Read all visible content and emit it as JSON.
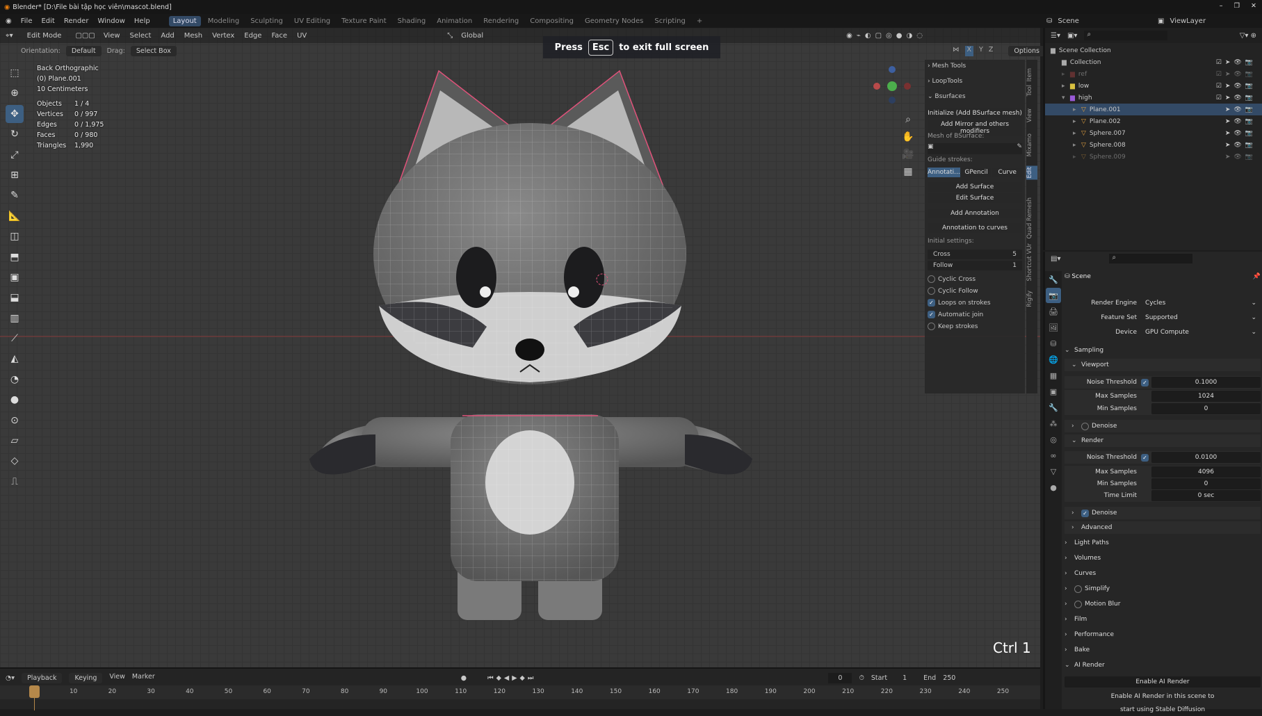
{
  "title": "Blender* [D:\\File bài tập học viên\\mascot.blend]",
  "window_controls": [
    "–",
    "❐",
    "✕"
  ],
  "menu": [
    "File",
    "Edit",
    "Render",
    "Window",
    "Help"
  ],
  "workspaces": [
    "Layout",
    "Modeling",
    "Sculpting",
    "UV Editing",
    "Texture Paint",
    "Shading",
    "Animation",
    "Rendering",
    "Compositing",
    "Geometry Nodes",
    "Scripting",
    "+"
  ],
  "active_workspace": "Layout",
  "scene_label": "Scene",
  "viewlayer_label": "ViewLayer",
  "viewport_header": {
    "mode": "Edit Mode",
    "menus": [
      "View",
      "Select",
      "Add",
      "Mesh",
      "Vertex",
      "Edge",
      "Face",
      "UV"
    ],
    "transform_orientation": "Global"
  },
  "tool_settings": {
    "orientation_label": "Orientation:",
    "orientation": "Default",
    "drag_label": "Drag:",
    "drag": "Select Box",
    "axes": [
      "X",
      "Y",
      "Z"
    ],
    "options": "Options"
  },
  "overlay": {
    "view": "Back Orthographic",
    "object": "(0) Plane.001",
    "scale": "10 Centimeters",
    "stats": [
      [
        "Objects",
        "1 / 4"
      ],
      [
        "Vertices",
        "0 / 997"
      ],
      [
        "Edges",
        "0 / 1,975"
      ],
      [
        "Faces",
        "0 / 980"
      ],
      [
        "Triangles",
        "1,990"
      ]
    ]
  },
  "fullscreen_notice": {
    "press": "Press",
    "key": "Esc",
    "rest": "to exit full screen"
  },
  "key_hint": "Ctrl 1",
  "left_tools": [
    "select-box",
    "cursor",
    "move",
    "rotate",
    "scale",
    "transform",
    "annotate",
    "measure",
    "add-cube",
    "extrude",
    "inset",
    "bevel",
    "loop-cut",
    "knife",
    "poly-build",
    "spin",
    "smooth",
    "shrink-fatten",
    "shear",
    "rip",
    "edge-slide"
  ],
  "npanel": {
    "sections": [
      "Mesh Tools",
      "LoopTools",
      "Bsurfaces"
    ],
    "initialize": "Initialize (Add BSurface mesh)",
    "add_mirror": "Add Mirror and others modifiers",
    "mesh_label": "Mesh of BSurface:",
    "guide_label": "Guide strokes:",
    "guide_tabs": [
      "Annotati...",
      "GPencil",
      "Curve"
    ],
    "add_surface": "Add Surface",
    "edit_surface": "Edit Surface",
    "add_annotation": "Add Annotation",
    "annotation_to_curves": "Annotation to curves",
    "initial_label": "Initial settings:",
    "cross_label": "Cross",
    "cross": "5",
    "follow_label": "Follow",
    "follow": "1",
    "checks": [
      {
        "label": "Cyclic Cross",
        "on": false
      },
      {
        "label": "Cyclic Follow",
        "on": false
      },
      {
        "label": "Loops on strokes",
        "on": true
      },
      {
        "label": "Automatic join",
        "on": true
      },
      {
        "label": "Keep strokes",
        "on": false
      }
    ],
    "tabs": [
      "Item",
      "Tool",
      "View",
      "Mixamo",
      "Edit",
      "Quad Remesh",
      "Shortcut VUr",
      "Rigify"
    ],
    "active_tab": "Edit"
  },
  "outliner": {
    "rows": [
      {
        "label": "Scene Collection",
        "depth": 0,
        "icon": "collection"
      },
      {
        "label": "Collection",
        "depth": 1,
        "icon": "collection"
      },
      {
        "label": "ref",
        "depth": 1,
        "icon": "collection-red",
        "dim": true
      },
      {
        "label": "low",
        "depth": 1,
        "icon": "collection-yellow"
      },
      {
        "label": "high",
        "depth": 1,
        "icon": "collection-purple"
      },
      {
        "label": "Plane.001",
        "depth": 2,
        "icon": "mesh",
        "selected": true
      },
      {
        "label": "Plane.002",
        "depth": 2,
        "icon": "mesh"
      },
      {
        "label": "Sphere.007",
        "depth": 2,
        "icon": "mesh"
      },
      {
        "label": "Sphere.008",
        "depth": 2,
        "icon": "mesh"
      },
      {
        "label": "Sphere.009",
        "depth": 2,
        "icon": "mesh",
        "dim": true
      }
    ]
  },
  "properties": {
    "context": "Scene",
    "render_engine_label": "Render Engine",
    "render_engine": "Cycles",
    "feature_set_label": "Feature Set",
    "feature_set": "Supported",
    "device_label": "Device",
    "device": "GPU Compute",
    "sampling": "Sampling",
    "viewport": "Viewport",
    "render": "Render",
    "noise_label": "Noise Threshold",
    "vp_noise": "0.1000",
    "max_label": "Max Samples",
    "vp_max": "1024",
    "min_label": "Min Samples",
    "vp_min": "0",
    "denoise": "Denoise",
    "r_noise": "0.0100",
    "r_max": "4096",
    "r_min": "0",
    "time_label": "Time Limit",
    "r_time": "0 sec",
    "advanced": "Advanced",
    "panels": [
      "Light Paths",
      "Volumes",
      "Curves",
      "Simplify",
      "Motion Blur",
      "Film",
      "Performance",
      "Bake"
    ],
    "ai_render": "AI Render",
    "enable_ai": "Enable AI Render",
    "ai_note1": "Enable AI Render in this scene to",
    "ai_note2": "start using Stable Diffusion"
  },
  "timeline": {
    "menus": [
      "Playback",
      "Keying",
      "View",
      "Marker"
    ],
    "current_frame": "0",
    "start_label": "Start",
    "start": "1",
    "end_label": "End",
    "end": "250",
    "ticks": [
      "0",
      "10",
      "20",
      "30",
      "40",
      "50",
      "60",
      "70",
      "80",
      "90",
      "100",
      "110",
      "120",
      "130",
      "140",
      "150",
      "160",
      "170",
      "180",
      "190",
      "200",
      "210",
      "220",
      "230",
      "240",
      "250"
    ]
  },
  "colors": {
    "accent": "#334a66",
    "active_tool": "#3d5f82",
    "x_axis": "#b84a4a",
    "selection_edge": "#e0527a"
  }
}
